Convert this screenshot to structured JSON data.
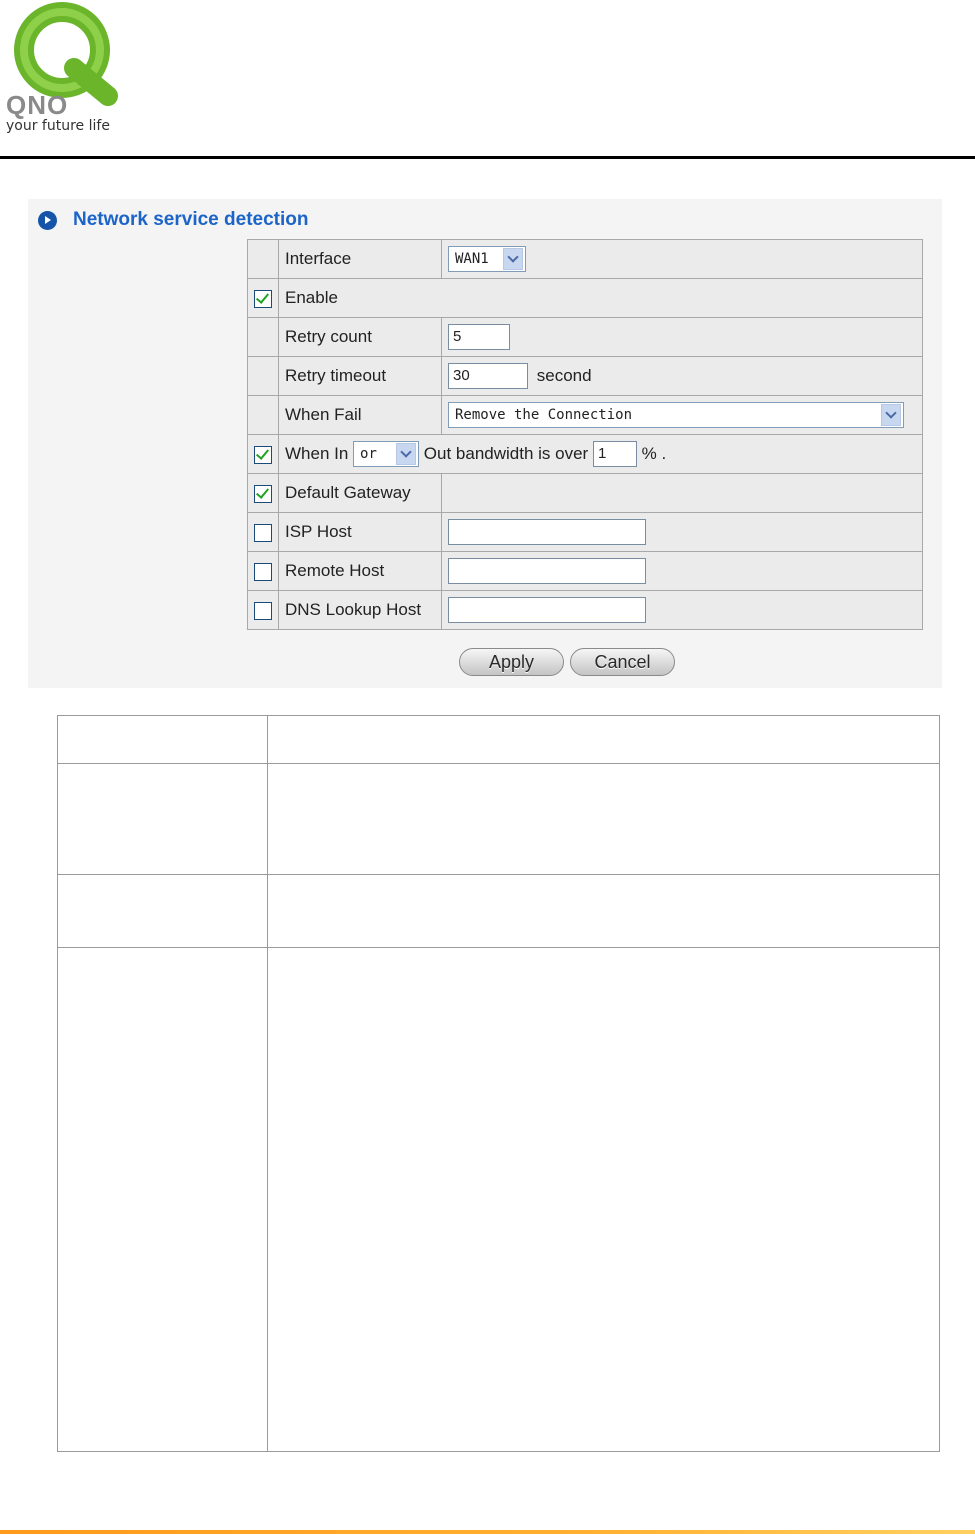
{
  "logo": {
    "brand": "QNO",
    "tagline": "your future life"
  },
  "section": {
    "title": "Network service detection"
  },
  "form": {
    "interface": {
      "label": "Interface",
      "value": "WAN1"
    },
    "enable": {
      "label": "Enable",
      "checked": true
    },
    "retry_count": {
      "label": "Retry count",
      "value": "5"
    },
    "retry_timeout": {
      "label": "Retry timeout",
      "value": "30",
      "unit": "second"
    },
    "when_fail": {
      "label": "When Fail",
      "value": "Remove the Connection"
    },
    "bandwidth": {
      "checked": true,
      "label_prefix": "When In",
      "op_value": "or",
      "label_mid": "Out bandwidth is over",
      "value": "1",
      "label_suffix": "% ."
    },
    "default_gateway": {
      "label": "Default Gateway",
      "checked": true
    },
    "isp_host": {
      "label": "ISP Host",
      "checked": false,
      "value": ""
    },
    "remote_host": {
      "label": "Remote Host",
      "checked": false,
      "value": ""
    },
    "dns_lookup_host": {
      "label": "DNS Lookup Host",
      "checked": false,
      "value": ""
    }
  },
  "buttons": {
    "apply": "Apply",
    "cancel": "Cancel"
  },
  "colors": {
    "title": "#1c64c8",
    "bullet": "#1654a8",
    "check": "#21a321",
    "footer": "#ff9a1a"
  }
}
